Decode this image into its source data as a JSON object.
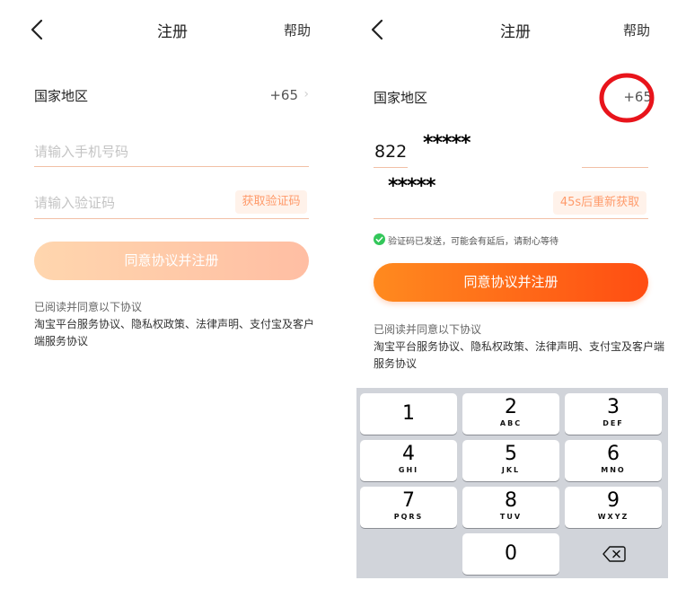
{
  "left": {
    "nav": {
      "back": "<",
      "title": "注册",
      "help": "帮助"
    },
    "region": {
      "label": "国家地区",
      "code": "+65",
      "chevron": "›"
    },
    "phone_placeholder": "请输入手机号码",
    "code_placeholder": "请输入验证码",
    "get_code_button": "获取验证码",
    "submit_button": "同意协议并注册",
    "agreement_intro": "已阅读并同意以下协议",
    "agreement_links": "淘宝平台服务协议、隐私权政策、法律声明、支付宝及客户端服务协议"
  },
  "right": {
    "nav": {
      "back": "<",
      "title": "注册",
      "help": "帮助"
    },
    "region": {
      "label": "国家地区",
      "code": "+65"
    },
    "phone_prefix": "822",
    "phone_masked": "*****",
    "code_masked": "*****",
    "resend_button": "45s后重新获取",
    "sent_notice": "验证码已发送，可能会有延后，请耐心等待",
    "submit_button": "同意协议并注册",
    "agreement_intro": "已阅读并同意以下协议",
    "agreement_links": "淘宝平台服务协议、隐私权政策、法律声明、支付宝及客户端服务协议",
    "keypad": [
      {
        "num": "1",
        "letters": ""
      },
      {
        "num": "2",
        "letters": "ABC"
      },
      {
        "num": "3",
        "letters": "DEF"
      },
      {
        "num": "4",
        "letters": "GHI"
      },
      {
        "num": "5",
        "letters": "JKL"
      },
      {
        "num": "6",
        "letters": "MNO"
      },
      {
        "num": "7",
        "letters": "PQRS"
      },
      {
        "num": "8",
        "letters": "TUV"
      },
      {
        "num": "9",
        "letters": "WXYZ"
      },
      {
        "num": "0",
        "letters": ""
      }
    ]
  },
  "colors": {
    "accent_start": "#ff8a1f",
    "accent_end": "#ff4d12",
    "disabled_start": "#ffd0a6",
    "disabled_end": "#ffbea3",
    "annotation_red": "#e8141b",
    "success_green": "#33c75a"
  },
  "icons": [
    "back-chevron-icon",
    "chevron-right-icon",
    "check-circle-icon",
    "backspace-icon",
    "annotation-circle"
  ]
}
